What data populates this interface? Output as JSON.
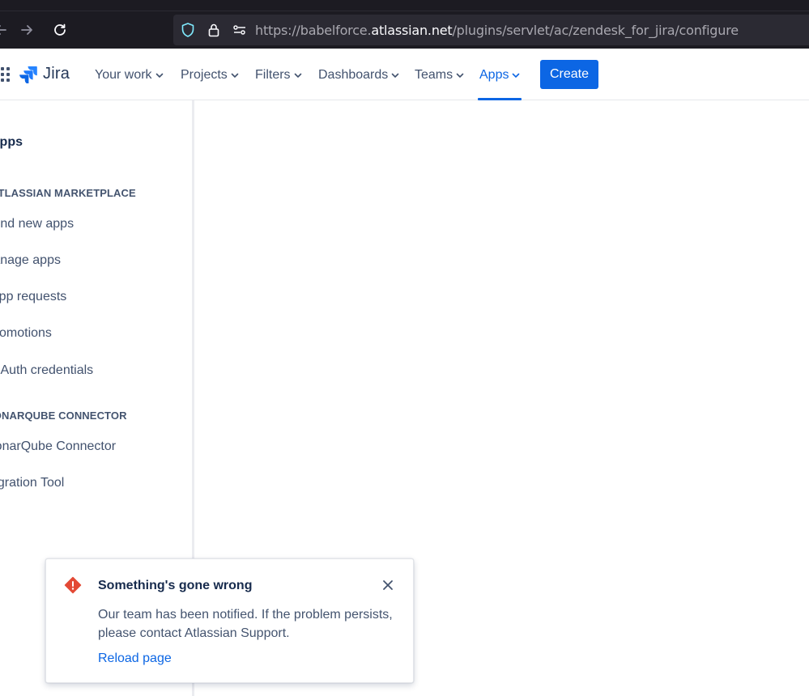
{
  "browser": {
    "url_prefix": "https://babelforce.",
    "url_host": "atlassian.net",
    "url_path": "/plugins/servlet/ac/zendesk_for_jira/configure"
  },
  "topnav": {
    "logo_text": "Jira",
    "items": [
      {
        "label": "Your work"
      },
      {
        "label": "Projects"
      },
      {
        "label": "Filters"
      },
      {
        "label": "Dashboards"
      },
      {
        "label": "Teams"
      },
      {
        "label": "Apps"
      }
    ],
    "active_item": "Apps",
    "create_label": "Create"
  },
  "sidebar": {
    "heading": "Apps",
    "sections": [
      {
        "title": "ATLASSIAN MARKETPLACE",
        "items": [
          "Find new apps",
          "Manage apps",
          "App requests",
          "Promotions",
          "OAuth credentials"
        ]
      },
      {
        "title": "SONARQUBE CONNECTOR",
        "items": [
          "SonarQube Connector",
          "Migration Tool"
        ]
      }
    ]
  },
  "flag": {
    "title": "Something's gone wrong",
    "body_line1": "Our team has been notified. If the problem persists,",
    "body_line2": "please contact Atlassian Support.",
    "action": "Reload page"
  },
  "colors": {
    "brand_blue": "#0c66e4",
    "error_red": "#e34935",
    "browser_dark": "#1c1b22"
  }
}
